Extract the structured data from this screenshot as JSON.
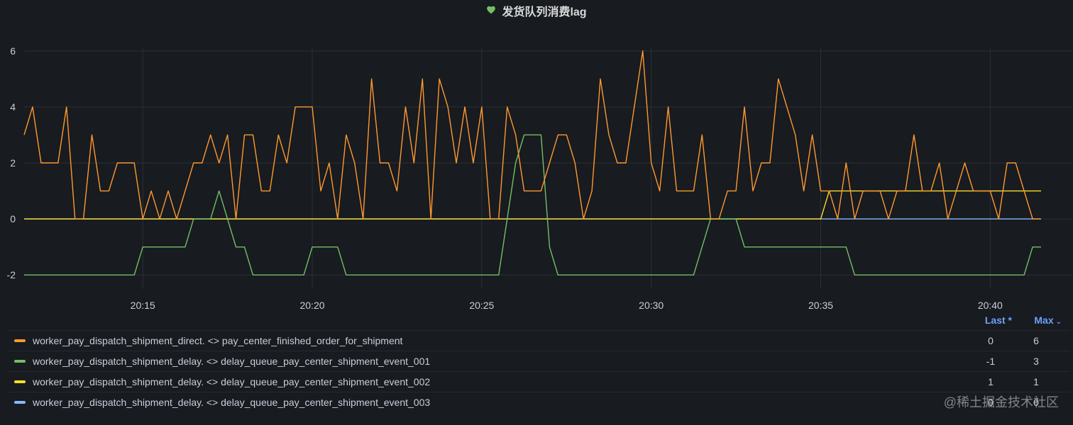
{
  "panel": {
    "title": "发货队列消费lag",
    "status_icon": "heart-icon",
    "status_color": "#73bf69"
  },
  "legend": {
    "columns": {
      "last": "Last *",
      "max": "Max"
    },
    "rows": [
      {
        "name": "worker_pay_dispatch_shipment_direct. <> pay_center_finished_order_for_shipment",
        "color": "#ff9830",
        "last": "0",
        "max": "6"
      },
      {
        "name": "worker_pay_dispatch_shipment_delay. <> delay_queue_pay_center_shipment_event_001",
        "color": "#73bf69",
        "last": "-1",
        "max": "3"
      },
      {
        "name": "worker_pay_dispatch_shipment_delay. <> delay_queue_pay_center_shipment_event_002",
        "color": "#fade2a",
        "last": "1",
        "max": "1"
      },
      {
        "name": "worker_pay_dispatch_shipment_delay. <> delay_queue_pay_center_shipment_event_003",
        "color": "#8ab8ff",
        "last": "0",
        "max": "0"
      }
    ]
  },
  "watermark": "@稀土掘金技术社区",
  "chart_data": {
    "type": "line",
    "x_ticks": [
      "20:15",
      "20:20",
      "20:25",
      "20:30",
      "20:35",
      "20:40"
    ],
    "y_ticks": [
      -2,
      0,
      2,
      4,
      6
    ],
    "ylim": [
      -2.5,
      6.5
    ],
    "x_start": "20:11:30",
    "x_step_seconds": 15,
    "grid": true,
    "series": [
      {
        "name": "worker_pay_dispatch_shipment_direct. <> pay_center_finished_order_for_shipment",
        "color": "#ff9830",
        "values": [
          3,
          4,
          2,
          2,
          2,
          4,
          0,
          0,
          3,
          1,
          1,
          2,
          2,
          2,
          0,
          1,
          0,
          1,
          0,
          1,
          2,
          2,
          3,
          2,
          3,
          0,
          3,
          3,
          1,
          1,
          3,
          2,
          4,
          4,
          4,
          1,
          2,
          0,
          3,
          2,
          0,
          5,
          2,
          2,
          1,
          4,
          2,
          5,
          0,
          5,
          4,
          2,
          4,
          2,
          4,
          0,
          0,
          4,
          3,
          1,
          1,
          1,
          2,
          3,
          3,
          2,
          0,
          1,
          5,
          3,
          2,
          2,
          4,
          6,
          2,
          1,
          4,
          1,
          1,
          1,
          3,
          0,
          0,
          1,
          1,
          4,
          1,
          2,
          2,
          5,
          4,
          3,
          1,
          3,
          1,
          1,
          0,
          2,
          0,
          1,
          1,
          1,
          0,
          1,
          1,
          3,
          1,
          1,
          2,
          0,
          1,
          2,
          1,
          1,
          1,
          0,
          2,
          2,
          1,
          0,
          0
        ]
      },
      {
        "name": "worker_pay_dispatch_shipment_delay. <> delay_queue_pay_center_shipment_event_001",
        "color": "#73bf69",
        "values": [
          -2,
          -2,
          -2,
          -2,
          -2,
          -2,
          -2,
          -2,
          -2,
          -2,
          -2,
          -2,
          -2,
          -2,
          -1,
          -1,
          -1,
          -1,
          -1,
          -1,
          0,
          0,
          0,
          1,
          0,
          -1,
          -1,
          -2,
          -2,
          -2,
          -2,
          -2,
          -2,
          -2,
          -1,
          -1,
          -1,
          -1,
          -2,
          -2,
          -2,
          -2,
          -2,
          -2,
          -2,
          -2,
          -2,
          -2,
          -2,
          -2,
          -2,
          -2,
          -2,
          -2,
          -2,
          -2,
          -2,
          0,
          2,
          3,
          3,
          3,
          -1,
          -2,
          -2,
          -2,
          -2,
          -2,
          -2,
          -2,
          -2,
          -2,
          -2,
          -2,
          -2,
          -2,
          -2,
          -2,
          -2,
          -2,
          -1,
          0,
          0,
          0,
          0,
          -1,
          -1,
          -1,
          -1,
          -1,
          -1,
          -1,
          -1,
          -1,
          -1,
          -1,
          -1,
          -1,
          -2,
          -2,
          -2,
          -2,
          -2,
          -2,
          -2,
          -2,
          -2,
          -2,
          -2,
          -2,
          -2,
          -2,
          -2,
          -2,
          -2,
          -2,
          -2,
          -2,
          -2,
          -1,
          -1
        ]
      },
      {
        "name": "worker_pay_dispatch_shipment_delay. <> delay_queue_pay_center_shipment_event_002",
        "color": "#fade2a",
        "values": [
          0,
          0,
          0,
          0,
          0,
          0,
          0,
          0,
          0,
          0,
          0,
          0,
          0,
          0,
          0,
          0,
          0,
          0,
          0,
          0,
          0,
          0,
          0,
          0,
          0,
          0,
          0,
          0,
          0,
          0,
          0,
          0,
          0,
          0,
          0,
          0,
          0,
          0,
          0,
          0,
          0,
          0,
          0,
          0,
          0,
          0,
          0,
          0,
          0,
          0,
          0,
          0,
          0,
          0,
          0,
          0,
          0,
          0,
          0,
          0,
          0,
          0,
          0,
          0,
          0,
          0,
          0,
          0,
          0,
          0,
          0,
          0,
          0,
          0,
          0,
          0,
          0,
          0,
          0,
          0,
          0,
          0,
          0,
          0,
          0,
          0,
          0,
          0,
          0,
          0,
          0,
          0,
          0,
          0,
          0,
          1,
          1,
          1,
          1,
          1,
          1,
          1,
          1,
          1,
          1,
          1,
          1,
          1,
          1,
          1,
          1,
          1,
          1,
          1,
          1,
          1,
          1,
          1,
          1,
          1,
          1
        ]
      },
      {
        "name": "worker_pay_dispatch_shipment_delay. <> delay_queue_pay_center_shipment_event_003",
        "color": "#8ab8ff",
        "values": [
          0,
          0,
          0,
          0,
          0,
          0,
          0,
          0,
          0,
          0,
          0,
          0,
          0,
          0,
          0,
          0,
          0,
          0,
          0,
          0,
          0,
          0,
          0,
          0,
          0,
          0,
          0,
          0,
          0,
          0,
          0,
          0,
          0,
          0,
          0,
          0,
          0,
          0,
          0,
          0,
          0,
          0,
          0,
          0,
          0,
          0,
          0,
          0,
          0,
          0,
          0,
          0,
          0,
          0,
          0,
          0,
          0,
          0,
          0,
          0,
          0,
          0,
          0,
          0,
          0,
          0,
          0,
          0,
          0,
          0,
          0,
          0,
          0,
          0,
          0,
          0,
          0,
          0,
          0,
          0,
          0,
          0,
          0,
          0,
          0,
          0,
          0,
          0,
          0,
          0,
          0,
          0,
          0,
          0,
          0,
          0,
          0,
          0,
          0,
          0,
          0,
          0,
          0,
          0,
          0,
          0,
          0,
          0,
          0,
          0,
          0,
          0,
          0,
          0,
          0,
          0,
          0,
          0,
          0,
          0,
          0
        ]
      }
    ]
  }
}
